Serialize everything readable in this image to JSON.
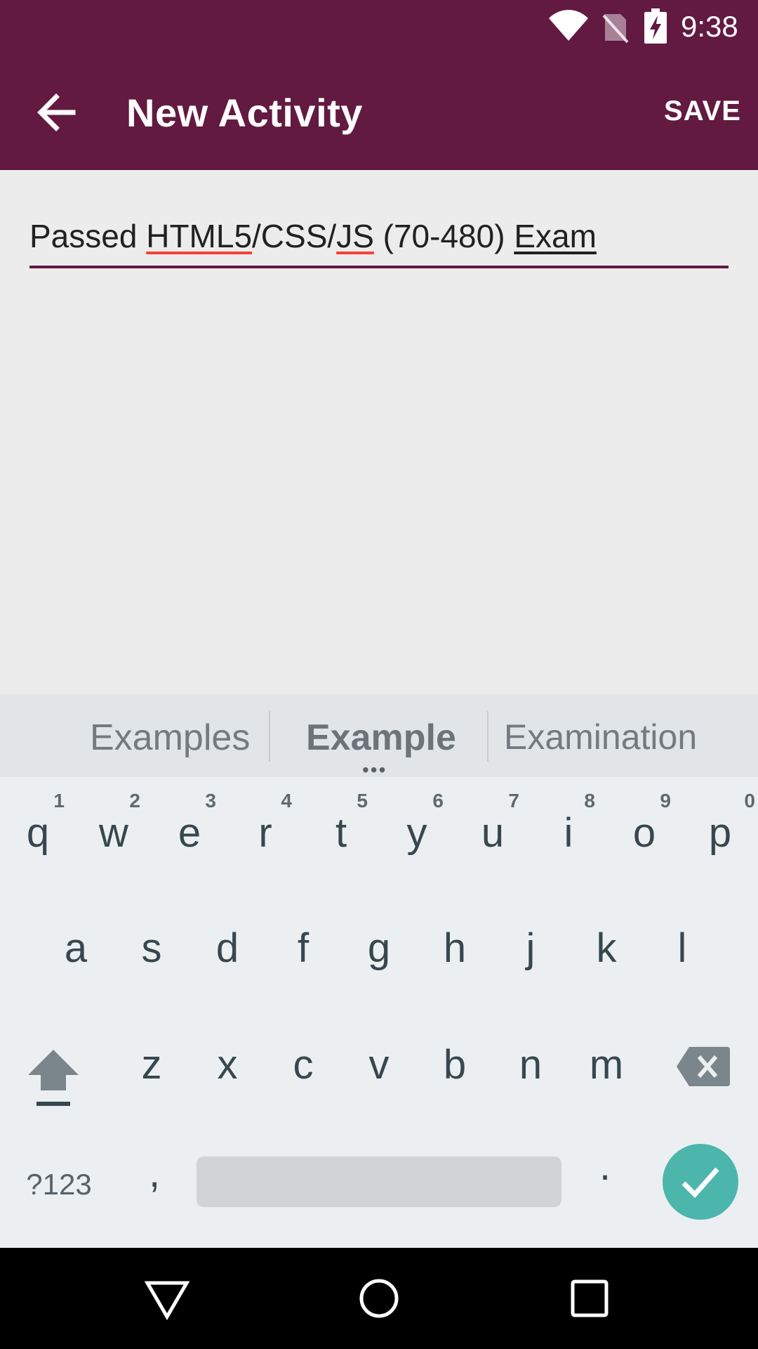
{
  "status_bar": {
    "time": "9:38",
    "icons": [
      "wifi-icon",
      "no-sim-icon",
      "battery-charging-icon"
    ]
  },
  "app_bar": {
    "back_icon": "arrow-back-icon",
    "title": "New Activity",
    "save_label": "SAVE",
    "color": "#621a41"
  },
  "text_field": {
    "parts": {
      "p1": "Passed ",
      "p2": "HTML5",
      "p3": "/CSS/",
      "p4": "JS",
      "p5": " (70-480) ",
      "p6": "Exam"
    },
    "value": "Passed HTML5/CSS/JS (70-480) Exam"
  },
  "suggestions": [
    "Examples",
    "Example",
    "Examination"
  ],
  "suggestion_more": "•••",
  "keyboard": {
    "row1": [
      {
        "k": "q",
        "n": "1"
      },
      {
        "k": "w",
        "n": "2"
      },
      {
        "k": "e",
        "n": "3"
      },
      {
        "k": "r",
        "n": "4"
      },
      {
        "k": "t",
        "n": "5"
      },
      {
        "k": "y",
        "n": "6"
      },
      {
        "k": "u",
        "n": "7"
      },
      {
        "k": "i",
        "n": "8"
      },
      {
        "k": "o",
        "n": "9"
      },
      {
        "k": "p",
        "n": "0"
      }
    ],
    "row2": [
      "a",
      "s",
      "d",
      "f",
      "g",
      "h",
      "j",
      "k",
      "l"
    ],
    "row3": [
      "z",
      "x",
      "c",
      "v",
      "b",
      "n",
      "m"
    ],
    "symbols_label": "?123",
    "comma": ",",
    "period": ".",
    "enter_color": "#4db6ac"
  },
  "nav_bar": [
    "nav-back-icon",
    "nav-home-icon",
    "nav-recents-icon"
  ]
}
